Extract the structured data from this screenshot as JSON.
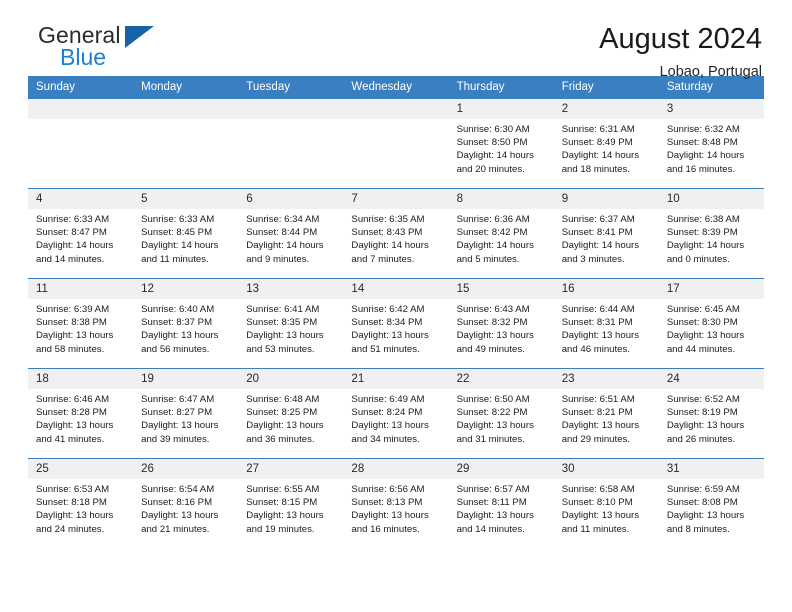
{
  "brand": {
    "word_one": "General",
    "word_two": "Blue",
    "triangle_icon": "triangle-icon"
  },
  "header": {
    "title": "August 2024",
    "subtitle": "Lobao, Portugal"
  },
  "colors": {
    "header_blue": "#3a7fc1",
    "brand_blue": "#1f7fd0",
    "daynum_gray": "#f0f0f0",
    "text": "#1c1c1c"
  },
  "weekdays": [
    "Sunday",
    "Monday",
    "Tuesday",
    "Wednesday",
    "Thursday",
    "Friday",
    "Saturday"
  ],
  "weeks": [
    [
      {
        "day": "",
        "empty": true,
        "sunrise": "",
        "sunset": "",
        "daylight_1": "",
        "daylight_2": ""
      },
      {
        "day": "",
        "empty": true,
        "sunrise": "",
        "sunset": "",
        "daylight_1": "",
        "daylight_2": ""
      },
      {
        "day": "",
        "empty": true,
        "sunrise": "",
        "sunset": "",
        "daylight_1": "",
        "daylight_2": ""
      },
      {
        "day": "",
        "empty": true,
        "sunrise": "",
        "sunset": "",
        "daylight_1": "",
        "daylight_2": ""
      },
      {
        "day": "1",
        "sunrise": "Sunrise: 6:30 AM",
        "sunset": "Sunset: 8:50 PM",
        "daylight_1": "Daylight: 14 hours",
        "daylight_2": "and 20 minutes."
      },
      {
        "day": "2",
        "sunrise": "Sunrise: 6:31 AM",
        "sunset": "Sunset: 8:49 PM",
        "daylight_1": "Daylight: 14 hours",
        "daylight_2": "and 18 minutes."
      },
      {
        "day": "3",
        "sunrise": "Sunrise: 6:32 AM",
        "sunset": "Sunset: 8:48 PM",
        "daylight_1": "Daylight: 14 hours",
        "daylight_2": "and 16 minutes."
      }
    ],
    [
      {
        "day": "4",
        "sunrise": "Sunrise: 6:33 AM",
        "sunset": "Sunset: 8:47 PM",
        "daylight_1": "Daylight: 14 hours",
        "daylight_2": "and 14 minutes."
      },
      {
        "day": "5",
        "sunrise": "Sunrise: 6:33 AM",
        "sunset": "Sunset: 8:45 PM",
        "daylight_1": "Daylight: 14 hours",
        "daylight_2": "and 11 minutes."
      },
      {
        "day": "6",
        "sunrise": "Sunrise: 6:34 AM",
        "sunset": "Sunset: 8:44 PM",
        "daylight_1": "Daylight: 14 hours",
        "daylight_2": "and 9 minutes."
      },
      {
        "day": "7",
        "sunrise": "Sunrise: 6:35 AM",
        "sunset": "Sunset: 8:43 PM",
        "daylight_1": "Daylight: 14 hours",
        "daylight_2": "and 7 minutes."
      },
      {
        "day": "8",
        "sunrise": "Sunrise: 6:36 AM",
        "sunset": "Sunset: 8:42 PM",
        "daylight_1": "Daylight: 14 hours",
        "daylight_2": "and 5 minutes."
      },
      {
        "day": "9",
        "sunrise": "Sunrise: 6:37 AM",
        "sunset": "Sunset: 8:41 PM",
        "daylight_1": "Daylight: 14 hours",
        "daylight_2": "and 3 minutes."
      },
      {
        "day": "10",
        "sunrise": "Sunrise: 6:38 AM",
        "sunset": "Sunset: 8:39 PM",
        "daylight_1": "Daylight: 14 hours",
        "daylight_2": "and 0 minutes."
      }
    ],
    [
      {
        "day": "11",
        "sunrise": "Sunrise: 6:39 AM",
        "sunset": "Sunset: 8:38 PM",
        "daylight_1": "Daylight: 13 hours",
        "daylight_2": "and 58 minutes."
      },
      {
        "day": "12",
        "sunrise": "Sunrise: 6:40 AM",
        "sunset": "Sunset: 8:37 PM",
        "daylight_1": "Daylight: 13 hours",
        "daylight_2": "and 56 minutes."
      },
      {
        "day": "13",
        "sunrise": "Sunrise: 6:41 AM",
        "sunset": "Sunset: 8:35 PM",
        "daylight_1": "Daylight: 13 hours",
        "daylight_2": "and 53 minutes."
      },
      {
        "day": "14",
        "sunrise": "Sunrise: 6:42 AM",
        "sunset": "Sunset: 8:34 PM",
        "daylight_1": "Daylight: 13 hours",
        "daylight_2": "and 51 minutes."
      },
      {
        "day": "15",
        "sunrise": "Sunrise: 6:43 AM",
        "sunset": "Sunset: 8:32 PM",
        "daylight_1": "Daylight: 13 hours",
        "daylight_2": "and 49 minutes."
      },
      {
        "day": "16",
        "sunrise": "Sunrise: 6:44 AM",
        "sunset": "Sunset: 8:31 PM",
        "daylight_1": "Daylight: 13 hours",
        "daylight_2": "and 46 minutes."
      },
      {
        "day": "17",
        "sunrise": "Sunrise: 6:45 AM",
        "sunset": "Sunset: 8:30 PM",
        "daylight_1": "Daylight: 13 hours",
        "daylight_2": "and 44 minutes."
      }
    ],
    [
      {
        "day": "18",
        "sunrise": "Sunrise: 6:46 AM",
        "sunset": "Sunset: 8:28 PM",
        "daylight_1": "Daylight: 13 hours",
        "daylight_2": "and 41 minutes."
      },
      {
        "day": "19",
        "sunrise": "Sunrise: 6:47 AM",
        "sunset": "Sunset: 8:27 PM",
        "daylight_1": "Daylight: 13 hours",
        "daylight_2": "and 39 minutes."
      },
      {
        "day": "20",
        "sunrise": "Sunrise: 6:48 AM",
        "sunset": "Sunset: 8:25 PM",
        "daylight_1": "Daylight: 13 hours",
        "daylight_2": "and 36 minutes."
      },
      {
        "day": "21",
        "sunrise": "Sunrise: 6:49 AM",
        "sunset": "Sunset: 8:24 PM",
        "daylight_1": "Daylight: 13 hours",
        "daylight_2": "and 34 minutes."
      },
      {
        "day": "22",
        "sunrise": "Sunrise: 6:50 AM",
        "sunset": "Sunset: 8:22 PM",
        "daylight_1": "Daylight: 13 hours",
        "daylight_2": "and 31 minutes."
      },
      {
        "day": "23",
        "sunrise": "Sunrise: 6:51 AM",
        "sunset": "Sunset: 8:21 PM",
        "daylight_1": "Daylight: 13 hours",
        "daylight_2": "and 29 minutes."
      },
      {
        "day": "24",
        "sunrise": "Sunrise: 6:52 AM",
        "sunset": "Sunset: 8:19 PM",
        "daylight_1": "Daylight: 13 hours",
        "daylight_2": "and 26 minutes."
      }
    ],
    [
      {
        "day": "25",
        "sunrise": "Sunrise: 6:53 AM",
        "sunset": "Sunset: 8:18 PM",
        "daylight_1": "Daylight: 13 hours",
        "daylight_2": "and 24 minutes."
      },
      {
        "day": "26",
        "sunrise": "Sunrise: 6:54 AM",
        "sunset": "Sunset: 8:16 PM",
        "daylight_1": "Daylight: 13 hours",
        "daylight_2": "and 21 minutes."
      },
      {
        "day": "27",
        "sunrise": "Sunrise: 6:55 AM",
        "sunset": "Sunset: 8:15 PM",
        "daylight_1": "Daylight: 13 hours",
        "daylight_2": "and 19 minutes."
      },
      {
        "day": "28",
        "sunrise": "Sunrise: 6:56 AM",
        "sunset": "Sunset: 8:13 PM",
        "daylight_1": "Daylight: 13 hours",
        "daylight_2": "and 16 minutes."
      },
      {
        "day": "29",
        "sunrise": "Sunrise: 6:57 AM",
        "sunset": "Sunset: 8:11 PM",
        "daylight_1": "Daylight: 13 hours",
        "daylight_2": "and 14 minutes."
      },
      {
        "day": "30",
        "sunrise": "Sunrise: 6:58 AM",
        "sunset": "Sunset: 8:10 PM",
        "daylight_1": "Daylight: 13 hours",
        "daylight_2": "and 11 minutes."
      },
      {
        "day": "31",
        "sunrise": "Sunrise: 6:59 AM",
        "sunset": "Sunset: 8:08 PM",
        "daylight_1": "Daylight: 13 hours",
        "daylight_2": "and 8 minutes."
      }
    ]
  ]
}
